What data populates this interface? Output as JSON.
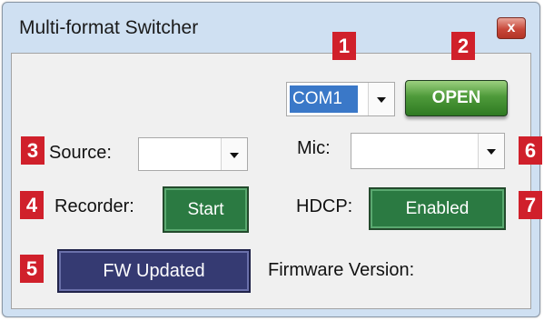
{
  "window": {
    "title": "Multi-format Switcher",
    "close_glyph": "x"
  },
  "port": {
    "value": "COM1",
    "open_label": "OPEN"
  },
  "source": {
    "label": "Source:",
    "value": ""
  },
  "mic": {
    "label": "Mic:",
    "value": ""
  },
  "recorder": {
    "label": "Recorder:",
    "button_label": "Start"
  },
  "hdcp": {
    "label": "HDCP:",
    "button_label": "Enabled"
  },
  "firmware": {
    "button_label": "FW Updated",
    "label": "Firmware Version:"
  },
  "badges": [
    "1",
    "2",
    "3",
    "4",
    "5",
    "6",
    "7"
  ],
  "colors": {
    "badge": "#d0202b",
    "green_button": "#2b7a42",
    "fw_button": "#353a72",
    "selection": "#3a78c8"
  }
}
